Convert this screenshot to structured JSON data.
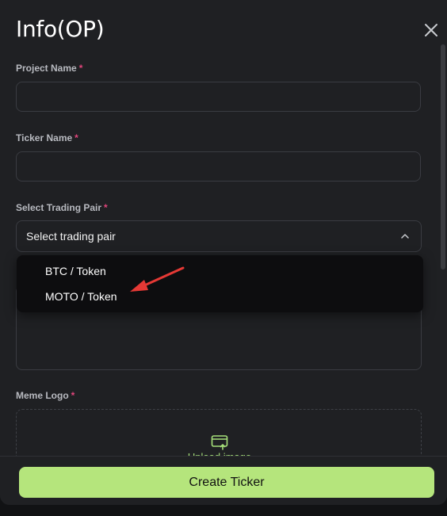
{
  "modal": {
    "title": "Info(OP)"
  },
  "form": {
    "project_name": {
      "label": "Project Name",
      "required_mark": "*",
      "value": ""
    },
    "ticker_name": {
      "label": "Ticker Name",
      "required_mark": "*",
      "value": ""
    },
    "trading_pair": {
      "label": "Select Trading Pair",
      "required_mark": "*",
      "selected_text": "Select trading pair",
      "options": [
        "BTC / Token",
        "MOTO / Token"
      ],
      "expanded": true
    },
    "meme_logo": {
      "label": "Meme Logo",
      "required_mark": "*",
      "upload_text": "Upload image"
    }
  },
  "footer": {
    "create_label": "Create Ticker"
  },
  "icons": {
    "close": "close-icon",
    "chevron": "chevron-up-icon",
    "upload": "upload-image-icon",
    "annotation_arrow": "red-arrow"
  },
  "colors": {
    "background": "#1f2023",
    "accent": "#b5e57c",
    "required": "#e0457b",
    "annotation": "#e53935"
  }
}
